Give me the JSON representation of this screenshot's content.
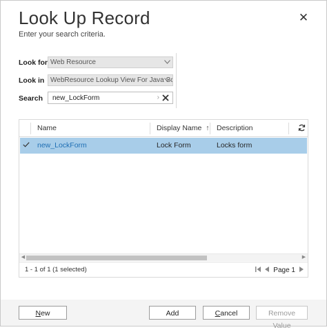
{
  "dialog": {
    "title": "Look Up Record",
    "subtitle": "Enter your search criteria.",
    "close_glyph": "✕"
  },
  "form": {
    "look_for": {
      "label": "Look for",
      "value": "Web Resource"
    },
    "look_in": {
      "label": "Look in",
      "value": "WebResource Lookup View For Java Sc"
    },
    "search": {
      "label": "Search",
      "value": "new_LockForm"
    }
  },
  "grid": {
    "columns": [
      {
        "label": "Name"
      },
      {
        "label": "Display Name",
        "sort": "↑"
      },
      {
        "label": "Description"
      }
    ],
    "rows": [
      {
        "selected": true,
        "name": "new_LockForm",
        "display_name": "Lock Form",
        "description": "Locks form"
      }
    ],
    "footer": {
      "count_text": "1 - 1 of 1 (1 selected)",
      "page_text": "Page 1"
    }
  },
  "buttons": {
    "new": {
      "label_first": "N",
      "label_rest": "ew"
    },
    "add": "Add",
    "cancel": {
      "label_first": "C",
      "label_rest": "ancel"
    },
    "remove_value": "Remove Value"
  },
  "icons": {
    "dropdown": "chevron-down-icon",
    "clear": "close-icon",
    "refresh": "refresh-icon",
    "check": "check-icon"
  },
  "colors": {
    "selected_row": "#a8cde9",
    "link": "#1f6fb4"
  }
}
